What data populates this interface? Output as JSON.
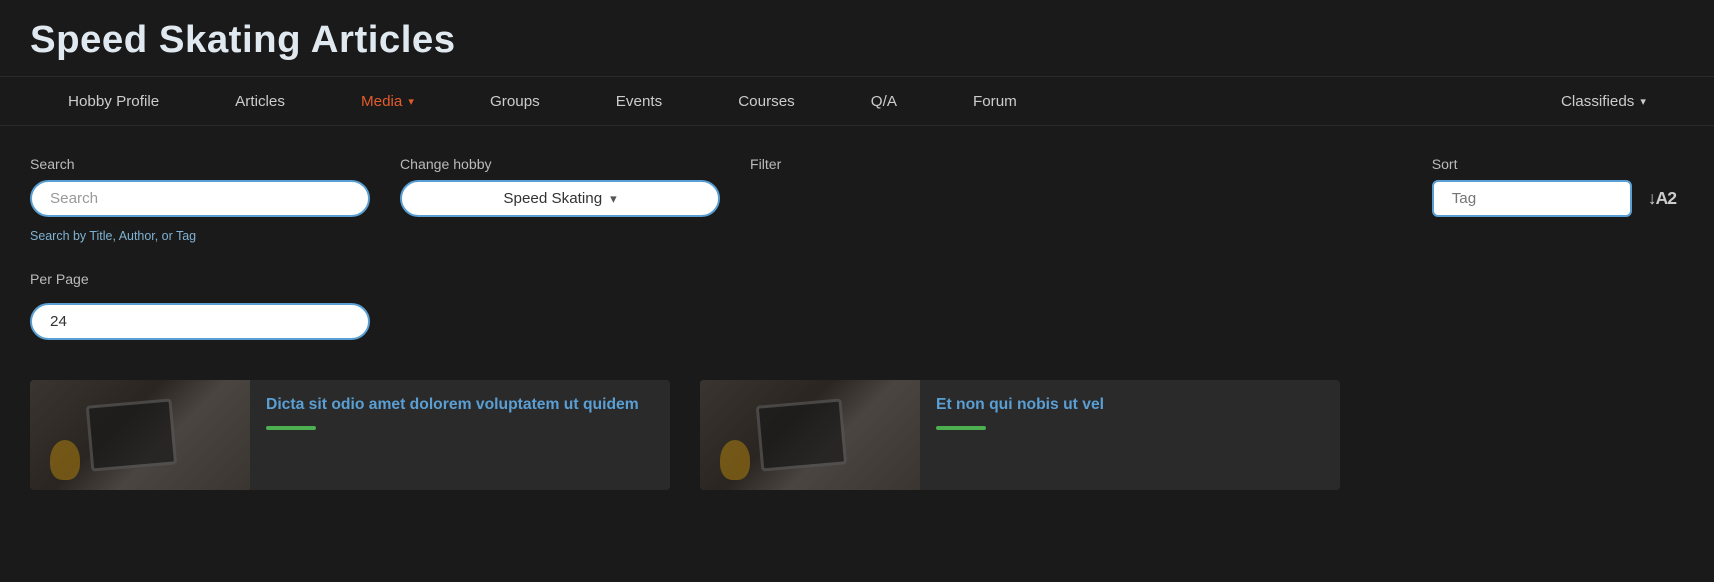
{
  "page": {
    "title": "Speed Skating Articles"
  },
  "nav": {
    "items": [
      {
        "label": "Hobby Profile",
        "active": false,
        "hasDropdown": false
      },
      {
        "label": "Articles",
        "active": false,
        "hasDropdown": false
      },
      {
        "label": "Media",
        "active": true,
        "hasDropdown": true
      },
      {
        "label": "Groups",
        "active": false,
        "hasDropdown": false
      },
      {
        "label": "Events",
        "active": false,
        "hasDropdown": false
      },
      {
        "label": "Courses",
        "active": false,
        "hasDropdown": false
      },
      {
        "label": "Q/A",
        "active": false,
        "hasDropdown": false
      },
      {
        "label": "Forum",
        "active": false,
        "hasDropdown": false
      },
      {
        "label": "Classifieds",
        "active": false,
        "hasDropdown": true
      }
    ]
  },
  "controls": {
    "search": {
      "label": "Search",
      "placeholder": "Search",
      "hint": "Search by Title, Author, or Tag"
    },
    "change_hobby": {
      "label": "Change hobby",
      "value": "Speed Skating"
    },
    "filter": {
      "label": "Filter"
    },
    "sort": {
      "label": "Sort",
      "placeholder": "Tag"
    },
    "per_page": {
      "label": "Per Page",
      "value": "24"
    }
  },
  "cards": [
    {
      "title": "Dicta sit odio amet dolorem voluptatem ut quidem",
      "accent_color": "#4caf50"
    },
    {
      "title": "Et non qui nobis ut vel",
      "accent_color": "#4caf50"
    }
  ],
  "icons": {
    "dropdown_arrow": "▾",
    "sort_alpha": "↓A2"
  }
}
